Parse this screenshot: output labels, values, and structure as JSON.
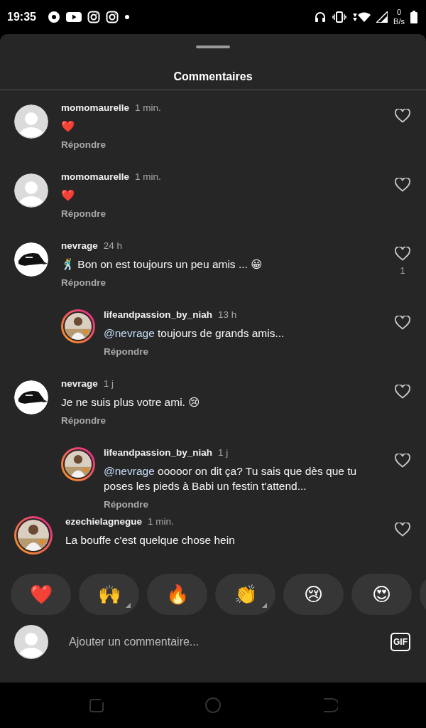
{
  "status_bar": {
    "time": "19:35",
    "net_speed_value": "0",
    "net_speed_unit": "B/s"
  },
  "sheet": {
    "title": "Commentaires"
  },
  "comments": [
    {
      "username": "momomaurelle",
      "time": "1 min.",
      "text": "❤️",
      "reply_label": "Répondre",
      "kind": "default",
      "reply": false
    },
    {
      "username": "momomaurelle",
      "time": "1 min.",
      "text": "❤️",
      "reply_label": "Répondre",
      "kind": "default",
      "reply": false
    },
    {
      "username": "nevrage",
      "time": "24 h",
      "text": "🕺 Bon on est toujours un peu amis ... 😀",
      "reply_label": "Répondre",
      "kind": "picture",
      "reply": false,
      "like_count": "1"
    },
    {
      "username": "lifeandpassion_by_niah",
      "time": "13 h",
      "mention": "@nevrage",
      "text": " toujours de grands amis...",
      "reply_label": "Répondre",
      "kind": "story",
      "reply": true
    },
    {
      "username": "nevrage",
      "time": "1 j",
      "text": "Je ne suis plus votre ami. 😢",
      "reply_label": "Répondre",
      "kind": "picture",
      "reply": false
    },
    {
      "username": "lifeandpassion_by_niah",
      "time": "1 j",
      "mention": "@nevrage",
      "text": " ooooor on dit ça? Tu sais que dès que tu poses les pieds à Babi un festin t'attend...",
      "reply_label": "Répondre",
      "kind": "story",
      "reply": true
    },
    {
      "username": "ezechielagnegue",
      "time": "1 min.",
      "text": "La bouffe c'est quelque chose hein",
      "kind": "story",
      "reply": false
    }
  ],
  "reactions": [
    {
      "emoji": "❤️",
      "variants": false
    },
    {
      "emoji": "🙌",
      "variants": true
    },
    {
      "emoji": "🔥",
      "variants": false
    },
    {
      "emoji": "👏",
      "variants": true
    },
    {
      "emoji": "😢",
      "variants": false
    },
    {
      "emoji": "😍",
      "variants": false
    }
  ],
  "composer": {
    "placeholder": "Ajouter un commentaire...",
    "gif_label": "GIF"
  }
}
